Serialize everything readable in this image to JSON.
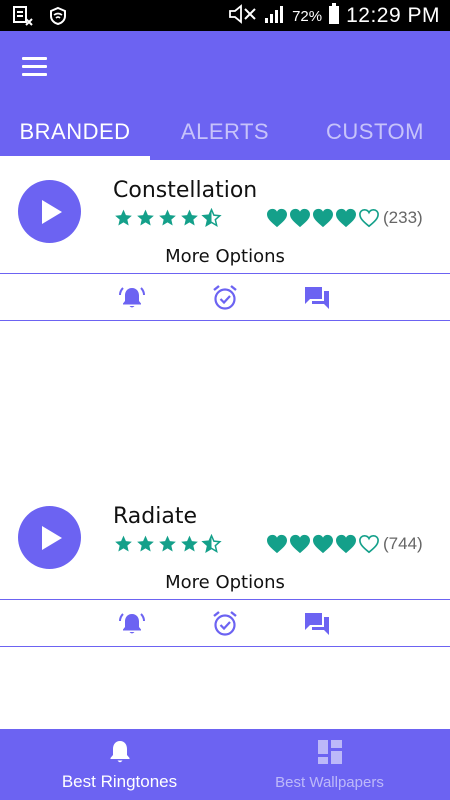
{
  "statusbar": {
    "battery_percent": "72%",
    "time": "12:29 PM",
    "left_icons": [
      "notification-icon",
      "shield-icon"
    ],
    "right_icons": [
      "mute-icon",
      "signal-icon",
      "battery-icon"
    ]
  },
  "appbar": {
    "menu_icon": "hamburger-menu-icon",
    "tabs": [
      {
        "label": "BRANDED",
        "active": true
      },
      {
        "label": "ALERTS",
        "active": false
      },
      {
        "label": "CUSTOM",
        "active": false
      }
    ]
  },
  "ringtones": [
    {
      "title": "Constellation",
      "star_rating": 4.5,
      "heart_rating": 4,
      "count": "(233)",
      "more_label": "More Options",
      "actions": [
        "alarm-bell-icon",
        "alarm-clock-icon",
        "message-icon"
      ]
    },
    {
      "title": "Radiate",
      "star_rating": 4.5,
      "heart_rating": 4,
      "count": "(744)",
      "more_label": "More Options",
      "actions": [
        "alarm-bell-icon",
        "alarm-clock-icon",
        "message-icon"
      ]
    }
  ],
  "bottomnav": {
    "items": [
      {
        "label": "Best Ringtones",
        "icon": "bell-icon",
        "active": true
      },
      {
        "label": "Best Wallpapers",
        "icon": "grid-icon",
        "active": false
      }
    ]
  },
  "colors": {
    "primary": "#6c63f2",
    "accent": "#14a08a",
    "statusbar": "#000000"
  }
}
